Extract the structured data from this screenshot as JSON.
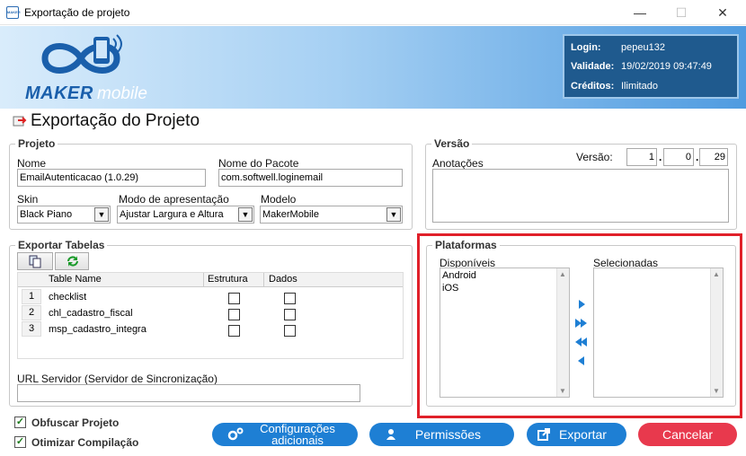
{
  "window": {
    "title": "Exportação de projeto",
    "app_icon_text": "MAKER",
    "minimize": "—",
    "maximize": "☐",
    "close": "✕"
  },
  "banner": {
    "logo_maker": "MAKER",
    "logo_mobile": "mobile",
    "login_label": "Login:",
    "login_value": "pepeu132",
    "validity_label": "Validade:",
    "validity_value": "19/02/2019 09:47:49",
    "credits_label": "Créditos:",
    "credits_value": "Ilimitado"
  },
  "header": {
    "title": "Exportação do Projeto",
    "icon": "export-icon"
  },
  "projeto": {
    "legend": "Projeto",
    "name_label": "Nome",
    "name_value": "EmailAutenticacao (1.0.29)",
    "package_label": "Nome do Pacote",
    "package_value": "com.softwell.loginemail",
    "skin_label": "Skin",
    "skin_value": "Black Piano",
    "mode_label": "Modo de apresentação",
    "mode_value": "Ajustar Largura e Altura",
    "model_label": "Modelo",
    "model_value": "MakerMobile"
  },
  "versao": {
    "legend": "Versão",
    "notes_label": "Anotações",
    "version_label": "Versão:",
    "major": "1",
    "minor": "0",
    "build": "29",
    "dot": "."
  },
  "tabelas": {
    "legend": "Exportar Tabelas",
    "columns": [
      "Table Name",
      "Estrutura",
      "Dados"
    ],
    "rows": [
      {
        "num": "1",
        "name": "checklist"
      },
      {
        "num": "2",
        "name": "chl_cadastro_fiscal"
      },
      {
        "num": "3",
        "name": "msp_cadastro_integra"
      }
    ],
    "url_label": "URL Servidor (Servidor de Sincronização)",
    "url_value": ""
  },
  "plataformas": {
    "legend": "Plataformas",
    "available_label": "Disponíveis",
    "available": [
      "Android",
      "iOS"
    ],
    "selected_label": "Selecionadas",
    "highlight_color": "#e0202a"
  },
  "options": {
    "obfuscate_label": "Obfuscar Projeto",
    "optimize_label": "Otimizar Compilação",
    "check": "✓"
  },
  "buttons": {
    "config_line1": "Configurações",
    "config_line2": "adicionais",
    "permissions": "Permissões",
    "export": "Exportar",
    "cancel": "Cancelar"
  },
  "colors": {
    "accent_blue": "#1e7fd4",
    "cancel_red": "#e8394d",
    "login_bg": "#1f5a8e"
  }
}
